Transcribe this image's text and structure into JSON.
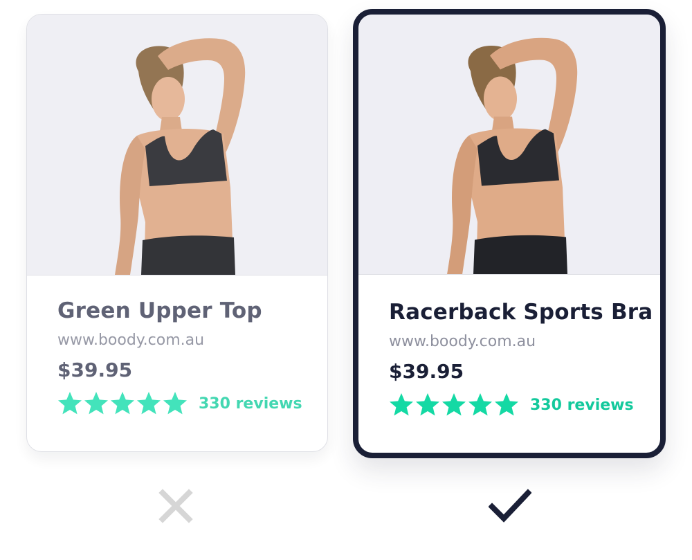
{
  "cards": [
    {
      "title": "Green Upper Top",
      "url": "www.boody.com.au",
      "price": "$39.95",
      "rating_stars": 5,
      "reviews": "330 reviews",
      "image": "woman-in-black-sports-bra-photo",
      "verdict_icon": "cross-icon"
    },
    {
      "title": "Racerback Sports Bra",
      "url": "www.boody.com.au",
      "price": "$39.95",
      "rating_stars": 5,
      "reviews": "330 reviews",
      "image": "woman-in-black-sports-bra-photo",
      "verdict_icon": "checkmark-icon"
    }
  ],
  "colors": {
    "star_green": "#2fe3b5",
    "review_green": "#13c99c",
    "selected_border": "#1a1f36",
    "cross_gray": "#d6d6d6",
    "photo_bg": "#eeeef4"
  }
}
